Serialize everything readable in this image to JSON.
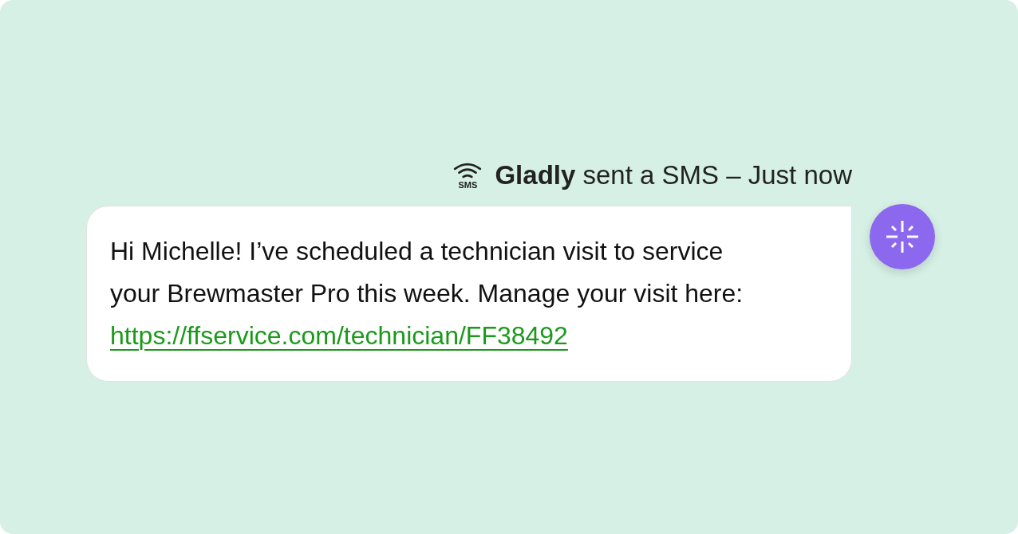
{
  "notification": {
    "channel_label": "SMS",
    "text": "**Gladly** sent a SMS – Just now"
  },
  "message": {
    "text": "Hi Michelle! I’ve scheduled a technician visit to service your Brewmaster Pro this week. Manage your visit here:",
    "link": "https://ffservice.com/technician/FF38492"
  }
}
